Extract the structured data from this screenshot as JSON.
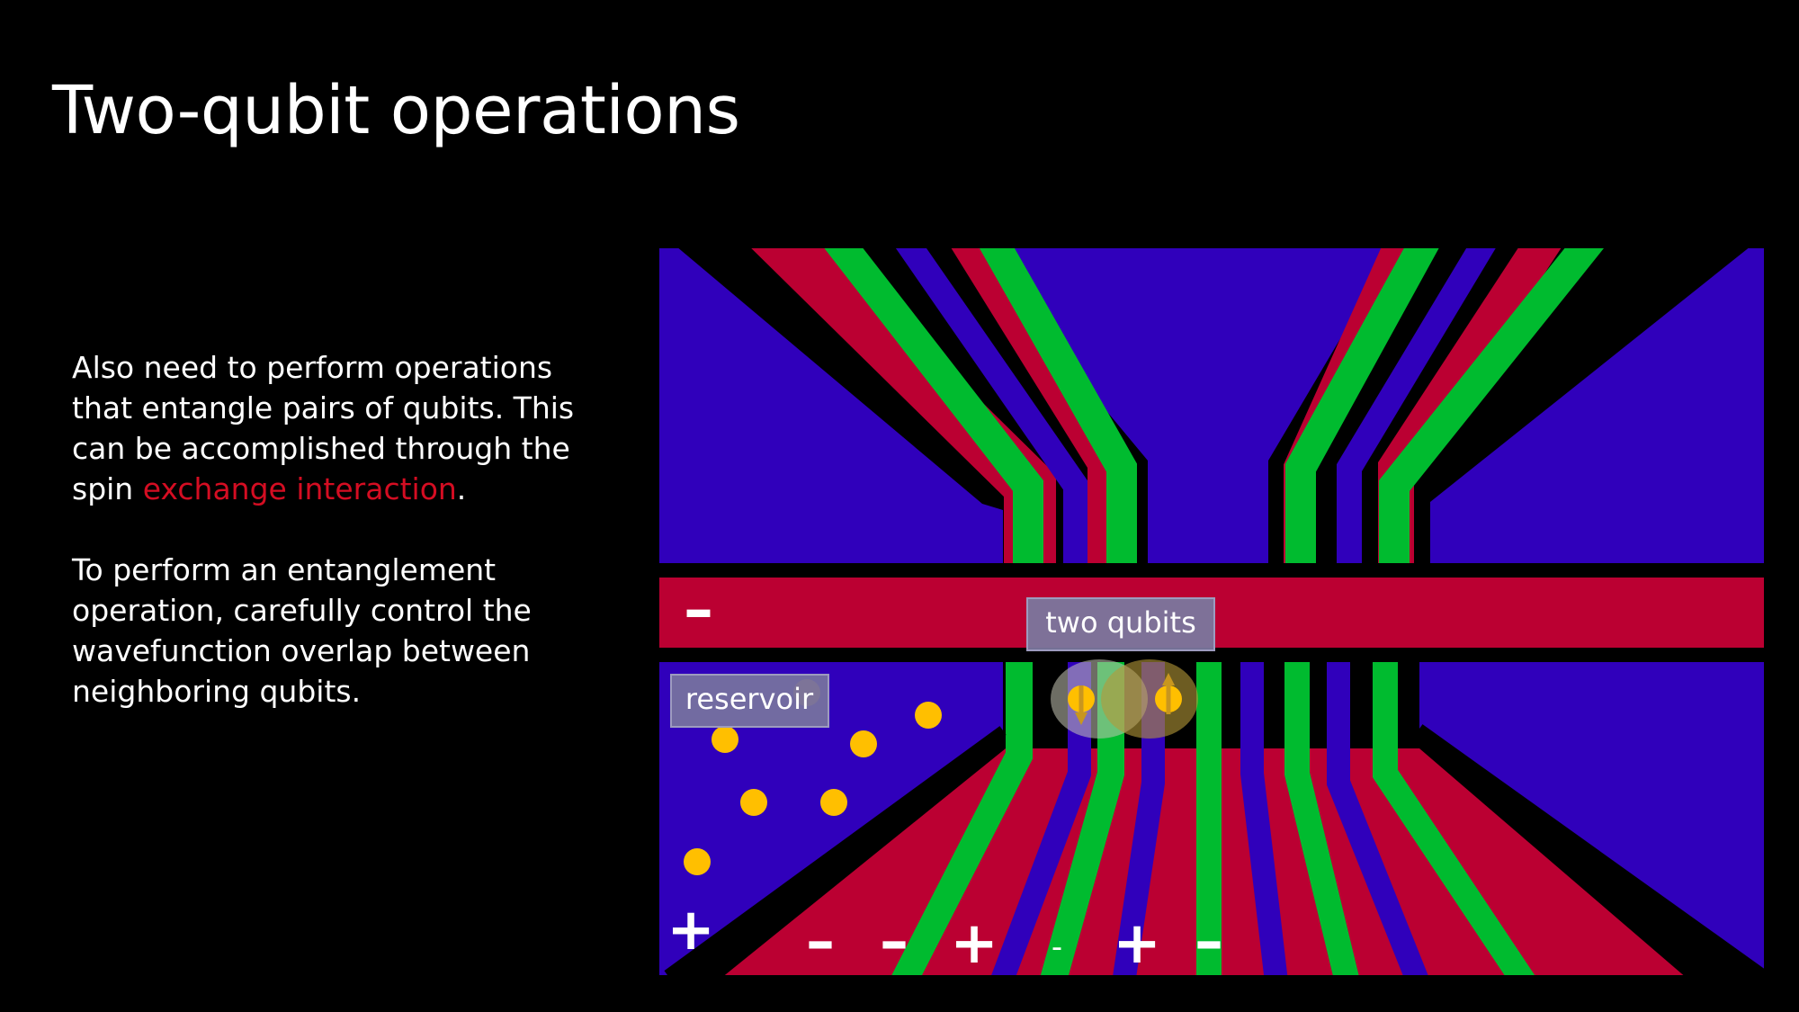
{
  "slide": {
    "title": "Two-qubit operations",
    "paragraph_1": {
      "before": "Also need to perform operations that entangle pairs of qubits. This can be accomplished through the spin ",
      "highlight": "exchange interaction",
      "after": "."
    },
    "paragraph_2": "To perform an entanglement operation, carefully control the wavefunction overlap between neighboring qubits."
  },
  "diagram": {
    "reservoir_label": "reservoir",
    "qubits_label": "two qubits",
    "barrier_sign": "–",
    "reservoir_sign": "+",
    "gate_signs": [
      "–",
      "–",
      "+",
      "-",
      "+",
      "–"
    ]
  },
  "colors": {
    "background": "#000000",
    "text": "#ffffff",
    "highlight": "#d40d22",
    "blue_gate": "#3000bb",
    "red_gate": "#bb0032",
    "green_gate": "#00bb2f",
    "electron": "#ffbf00",
    "label_box": "#7a779e"
  },
  "icons": {
    "electron": "electron-dot-icon",
    "spin_up": "spin-up-arrow-icon",
    "spin_down": "spin-down-arrow-icon"
  }
}
